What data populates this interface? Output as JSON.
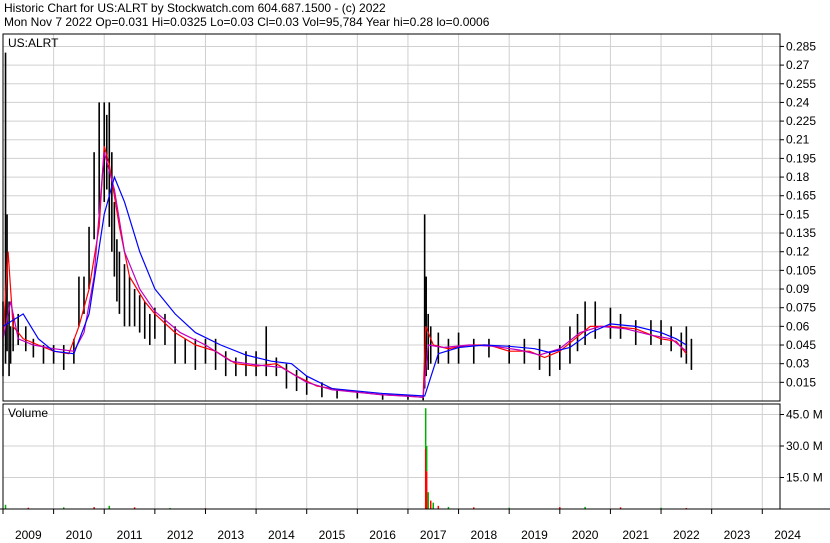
{
  "header": {
    "line1": "Historic Chart for US:ALRT by Stockwatch.com 604.687.1500 - (c) 2022",
    "line2": "Mon Nov  7 2022   Op=0.031   Hi=0.0325   Lo=0.03   Cl=0.03   Vol=95,784   Year hi=0.28   lo=0.0006"
  },
  "colors": {
    "price_bar": "#000000",
    "ma_short": "#ff0000",
    "ma_mid": "#c000c0",
    "ma_long": "#0000ff",
    "volume_green": "#00b000",
    "volume_red": "#ff0000",
    "grid": "#d0d0d0",
    "frame": "#000000"
  },
  "chart_data": [
    {
      "type": "line",
      "title": "US:ALRT",
      "description_of_series": "daily high-low price bars with moving averages",
      "y_tick_labels": [
        "0.285",
        "0.27",
        "0.255",
        "0.24",
        "0.225",
        "0.21",
        "0.195",
        "0.18",
        "0.165",
        "0.15",
        "0.135",
        "0.12",
        "0.105",
        "0.09",
        "0.075",
        "0.06",
        "0.045",
        "0.03",
        "0.015"
      ],
      "ylim": [
        0.0,
        0.295
      ],
      "x_tick_labels": [
        "2009",
        "2010",
        "2011",
        "2012",
        "2013",
        "2014",
        "2015",
        "2016",
        "2017",
        "2018",
        "2019",
        "2020",
        "2021",
        "2022",
        "2023",
        "2024"
      ],
      "xlim": [
        2009.0,
        2024.35
      ],
      "grid": true,
      "series": [
        {
          "name": "",
          "style": "hl-bars",
          "x": [
            2009.0,
            2009.05,
            2009.08,
            2009.12,
            2009.15,
            2009.2,
            2009.3,
            2009.45,
            2009.6,
            2009.8,
            2010.0,
            2010.2,
            2010.4,
            2010.5,
            2010.6,
            2010.7,
            2010.8,
            2010.9,
            2011.0,
            2011.05,
            2011.1,
            2011.15,
            2011.2,
            2011.25,
            2011.3,
            2011.4,
            2011.5,
            2011.6,
            2011.7,
            2011.8,
            2011.9,
            2012.0,
            2012.2,
            2012.4,
            2012.6,
            2012.8,
            2013.0,
            2013.2,
            2013.4,
            2013.6,
            2013.8,
            2014.0,
            2014.2,
            2014.4,
            2014.6,
            2014.8,
            2015.0,
            2015.3,
            2015.6,
            2016.0,
            2016.5,
            2017.0,
            2017.3,
            2017.33,
            2017.36,
            2017.4,
            2017.45,
            2017.6,
            2017.8,
            2018.0,
            2018.3,
            2018.6,
            2019.0,
            2019.3,
            2019.6,
            2019.8,
            2020.0,
            2020.2,
            2020.35,
            2020.5,
            2020.7,
            2021.0,
            2021.2,
            2021.5,
            2021.8,
            2022.0,
            2022.2,
            2022.4,
            2022.5,
            2022.6
          ],
          "low": [
            0.02,
            0.03,
            0.04,
            0.02,
            0.03,
            0.04,
            0.045,
            0.04,
            0.035,
            0.03,
            0.03,
            0.025,
            0.03,
            0.06,
            0.07,
            0.09,
            0.13,
            0.15,
            0.16,
            0.17,
            0.14,
            0.12,
            0.1,
            0.08,
            0.07,
            0.06,
            0.06,
            0.06,
            0.055,
            0.05,
            0.045,
            0.05,
            0.045,
            0.03,
            0.03,
            0.025,
            0.03,
            0.025,
            0.02,
            0.02,
            0.02,
            0.02,
            0.02,
            0.02,
            0.01,
            0.008,
            0.005,
            0.003,
            0.002,
            0.002,
            0.001,
            0.001,
            0.0006,
            0.01,
            0.02,
            0.025,
            0.03,
            0.03,
            0.03,
            0.03,
            0.03,
            0.035,
            0.03,
            0.03,
            0.025,
            0.02,
            0.025,
            0.03,
            0.04,
            0.045,
            0.05,
            0.05,
            0.05,
            0.045,
            0.045,
            0.045,
            0.04,
            0.035,
            0.03,
            0.025
          ],
          "high": [
            0.08,
            0.28,
            0.15,
            0.08,
            0.06,
            0.07,
            0.07,
            0.06,
            0.05,
            0.045,
            0.045,
            0.045,
            0.05,
            0.1,
            0.1,
            0.14,
            0.2,
            0.24,
            0.24,
            0.23,
            0.24,
            0.2,
            0.16,
            0.13,
            0.12,
            0.11,
            0.1,
            0.09,
            0.085,
            0.08,
            0.07,
            0.075,
            0.07,
            0.06,
            0.05,
            0.05,
            0.05,
            0.05,
            0.04,
            0.035,
            0.04,
            0.04,
            0.06,
            0.035,
            0.03,
            0.025,
            0.02,
            0.015,
            0.01,
            0.008,
            0.006,
            0.005,
            0.004,
            0.15,
            0.1,
            0.07,
            0.06,
            0.055,
            0.05,
            0.055,
            0.05,
            0.05,
            0.045,
            0.05,
            0.05,
            0.04,
            0.045,
            0.06,
            0.07,
            0.08,
            0.08,
            0.075,
            0.07,
            0.065,
            0.065,
            0.065,
            0.06,
            0.055,
            0.06,
            0.05
          ]
        },
        {
          "name": "",
          "style": "ma-red",
          "x": [
            2009.0,
            2009.1,
            2009.2,
            2009.4,
            2009.7,
            2010.0,
            2010.3,
            2010.5,
            2010.7,
            2010.9,
            2011.0,
            2011.1,
            2011.3,
            2011.5,
            2011.8,
            2012.0,
            2012.4,
            2012.8,
            2013.2,
            2013.6,
            2014.0,
            2014.4,
            2014.8,
            2015.2,
            2015.8,
            2016.5,
            2017.0,
            2017.3,
            2017.35,
            2017.5,
            2017.8,
            2018.2,
            2018.6,
            2019.0,
            2019.4,
            2019.7,
            2020.0,
            2020.3,
            2020.6,
            2021.0,
            2021.5,
            2022.0,
            2022.3,
            2022.5
          ],
          "y": [
            0.05,
            0.12,
            0.06,
            0.05,
            0.045,
            0.04,
            0.038,
            0.06,
            0.09,
            0.14,
            0.205,
            0.19,
            0.14,
            0.1,
            0.08,
            0.07,
            0.055,
            0.045,
            0.04,
            0.03,
            0.028,
            0.03,
            0.02,
            0.012,
            0.008,
            0.005,
            0.004,
            0.003,
            0.06,
            0.045,
            0.042,
            0.045,
            0.045,
            0.04,
            0.04,
            0.035,
            0.04,
            0.05,
            0.06,
            0.06,
            0.058,
            0.05,
            0.048,
            0.038
          ]
        },
        {
          "name": "",
          "style": "ma-purple",
          "x": [
            2009.0,
            2009.15,
            2009.3,
            2009.6,
            2010.0,
            2010.4,
            2010.6,
            2010.8,
            2011.0,
            2011.2,
            2011.4,
            2011.7,
            2012.0,
            2012.5,
            2013.0,
            2013.5,
            2014.0,
            2014.5,
            2015.0,
            2015.5,
            2016.5,
            2017.3,
            2017.4,
            2017.7,
            2018.2,
            2018.7,
            2019.2,
            2019.6,
            2020.0,
            2020.4,
            2020.8,
            2021.3,
            2021.8,
            2022.2,
            2022.5
          ],
          "y": [
            0.05,
            0.08,
            0.05,
            0.045,
            0.042,
            0.04,
            0.055,
            0.1,
            0.2,
            0.17,
            0.12,
            0.09,
            0.072,
            0.055,
            0.045,
            0.032,
            0.029,
            0.027,
            0.015,
            0.009,
            0.005,
            0.003,
            0.045,
            0.043,
            0.045,
            0.044,
            0.041,
            0.037,
            0.042,
            0.055,
            0.06,
            0.058,
            0.053,
            0.05,
            0.04
          ]
        },
        {
          "name": "",
          "style": "ma-blue",
          "x": [
            2009.0,
            2009.2,
            2009.4,
            2009.7,
            2010.0,
            2010.4,
            2010.7,
            2011.0,
            2011.2,
            2011.4,
            2011.7,
            2012.0,
            2012.4,
            2012.8,
            2013.3,
            2013.8,
            2014.3,
            2014.7,
            2015.0,
            2015.5,
            2016.5,
            2017.33,
            2017.6,
            2018.0,
            2018.5,
            2019.0,
            2019.5,
            2019.8,
            2020.2,
            2020.6,
            2021.0,
            2021.5,
            2022.0,
            2022.3,
            2022.5
          ],
          "y": [
            0.06,
            0.065,
            0.07,
            0.05,
            0.04,
            0.038,
            0.07,
            0.15,
            0.18,
            0.16,
            0.12,
            0.09,
            0.07,
            0.055,
            0.045,
            0.037,
            0.032,
            0.03,
            0.02,
            0.01,
            0.006,
            0.004,
            0.038,
            0.043,
            0.045,
            0.044,
            0.042,
            0.039,
            0.043,
            0.055,
            0.062,
            0.06,
            0.055,
            0.05,
            0.045
          ]
        }
      ]
    },
    {
      "type": "bar",
      "title": "Volume",
      "y_tick_labels": [
        "45.0 M",
        "30.0 M",
        "15.0 M"
      ],
      "ylim": [
        0,
        50
      ],
      "x_tick_labels": [
        "2009",
        "2010",
        "2011",
        "2012",
        "2013",
        "2014",
        "2015",
        "2016",
        "2017",
        "2018",
        "2019",
        "2020",
        "2021",
        "2022",
        "2023",
        "2024"
      ],
      "xlim": [
        2009.0,
        2024.35
      ],
      "series": [
        {
          "name": "",
          "x": [
            2009.05,
            2009.5,
            2010.2,
            2010.8,
            2011.1,
            2011.6,
            2012.3,
            2013.0,
            2014.0,
            2015.0,
            2016.0,
            2017.0,
            2017.35,
            2017.37,
            2017.4,
            2017.45,
            2017.5,
            2017.6,
            2017.8,
            2018.3,
            2019.0,
            2020.0,
            2020.5,
            2021.2,
            2022.0,
            2022.5
          ],
          "values": [
            2.0,
            0.6,
            0.8,
            0.9,
            1.5,
            0.8,
            0.5,
            0.4,
            0.3,
            0.2,
            0.2,
            0.2,
            48.0,
            30.0,
            8.0,
            4.0,
            3.0,
            1.5,
            1.0,
            0.8,
            0.6,
            0.9,
            1.0,
            0.8,
            0.6,
            0.5
          ]
        }
      ]
    }
  ]
}
